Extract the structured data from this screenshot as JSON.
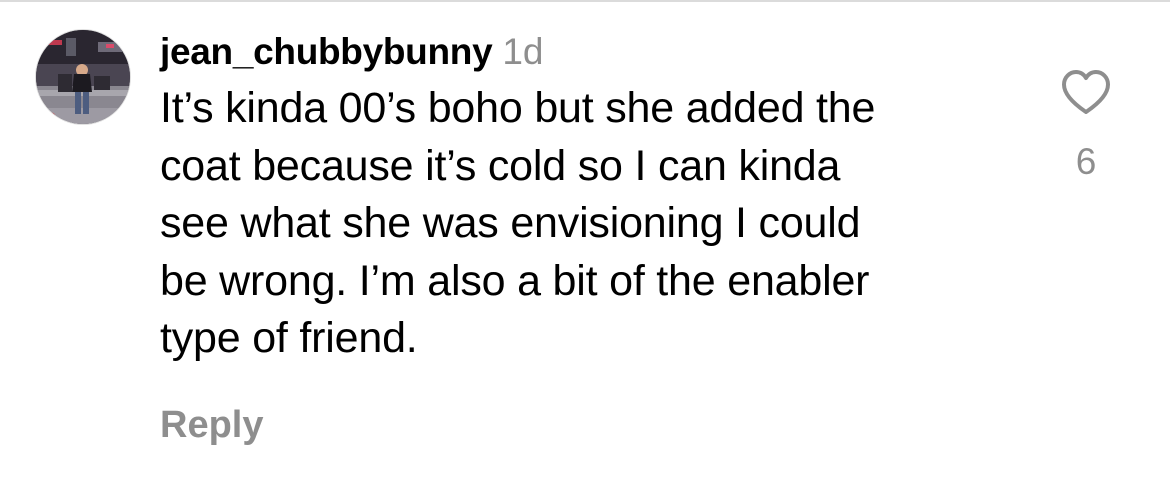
{
  "comment": {
    "username": "jean_chubbybunny",
    "timestamp": "1d",
    "text_lines": [
      "It’s kinda 00’s boho but she added the",
      "coat because it’s cold so I can kinda",
      "see what she was envisioning I could",
      "be wrong. I’m also a bit of the enabler",
      "type of friend."
    ],
    "reply_label": "Reply",
    "like_icon": "heart-outline-icon",
    "like_count": "6"
  },
  "colors": {
    "primary_text": "#000000",
    "secondary_text": "#8e8e8e",
    "background": "#ffffff"
  }
}
